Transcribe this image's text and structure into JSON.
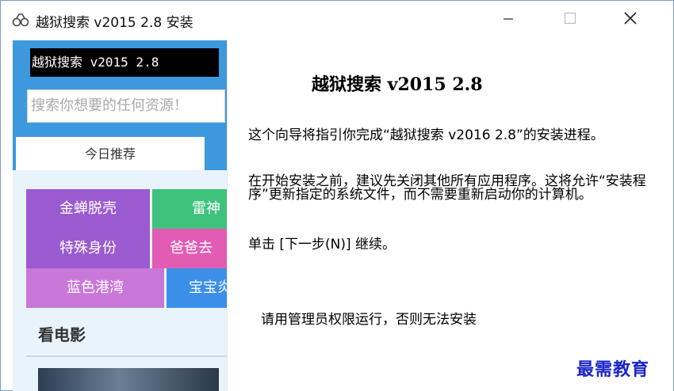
{
  "window": {
    "title": "越狱搜索 v2015 2.8 安装",
    "icon": "app-logo-icon"
  },
  "banner": {
    "title": "越狱搜索 v2015 2.8",
    "search_placeholder": "搜索你想要的任何资源！",
    "tab_label": "今日推荐",
    "tiles": [
      {
        "label": "金蝉脱壳",
        "color": "#9b5bd0"
      },
      {
        "label": "雷神",
        "color": "#3ec27c"
      },
      {
        "label": "特殊身份",
        "color": "#9b5bd0"
      },
      {
        "label": "爸爸去",
        "color": "#e25cb3"
      },
      {
        "label": "蓝色港湾",
        "color": "#c978d9"
      },
      {
        "label": "宝宝炎",
        "color": "#3c8fe8"
      }
    ],
    "section_title": "看电影"
  },
  "main": {
    "heading": "越狱搜索 v2015 2.8",
    "paragraph1": "这个向导将指引你完成“越狱搜索 v2016 2.8”的安装进程。",
    "paragraph2": "在开始安装之前，建议先关闭其他所有应用程序。这将允许“安装程序”更新指定的系统文件，而不需要重新启动你的计算机。",
    "paragraph3": "单击 [下一步(N)] 继续。",
    "admin_note": "请用管理员权限运行，否则无法安装"
  },
  "watermark": "最需教育",
  "colors": {
    "banner_blue": "#3d98dc",
    "watermark_blue": "#1a24c8"
  }
}
